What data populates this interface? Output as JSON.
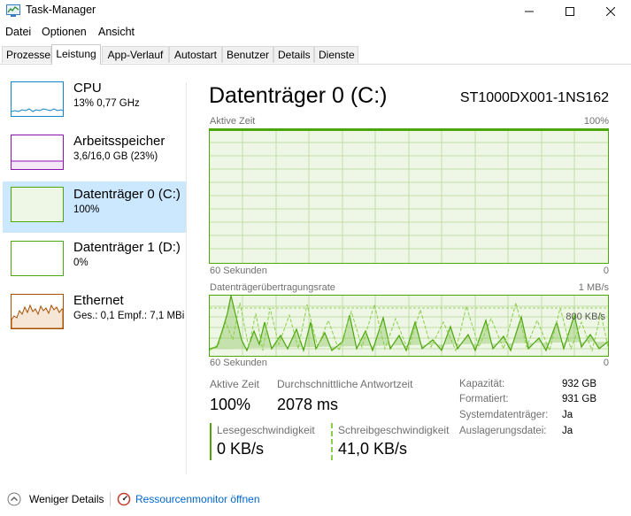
{
  "window": {
    "title": "Task-Manager"
  },
  "menu": [
    "Datei",
    "Optionen",
    "Ansicht"
  ],
  "tabs": [
    "Prozesse",
    "Leistung",
    "App-Verlauf",
    "Autostart",
    "Benutzer",
    "Details",
    "Dienste"
  ],
  "active_tab": "Leistung",
  "sidebar": [
    {
      "title": "CPU",
      "subtitle": "13% 0,77 GHz",
      "color": "#1185c7"
    },
    {
      "title": "Arbeitsspeicher",
      "subtitle": "3,6/16,0 GB (23%)",
      "color": "#8b12ae"
    },
    {
      "title": "Datenträger 0 (C:)",
      "subtitle": "100%",
      "color": "#4da60c"
    },
    {
      "title": "Datenträger 1 (D:)",
      "subtitle": "0%",
      "color": "#4da60c"
    },
    {
      "title": "Ethernet",
      "subtitle": "Ges.: 0,1  Empf.: 7,1 MBi",
      "color": "#a74f01"
    }
  ],
  "selected_sidebar_index": 2,
  "main": {
    "title": "Datenträger 0 (C:)",
    "model": "ST1000DX001-1NS162",
    "graph1": {
      "label": "Aktive Zeit",
      "max": "100%",
      "time": "60 Sekunden",
      "min": "0",
      "level_fraction": 1.0
    },
    "graph2": {
      "label": "Datenträgerübertragungsrate",
      "max": "1 MB/s",
      "mid": "800 KB/s",
      "time": "60 Sekunden",
      "min": "0"
    },
    "stats": {
      "active_time_label": "Aktive Zeit",
      "active_time_value": "100%",
      "avg_response_label": "Durchschnittliche Antwortzeit",
      "avg_response_value": "2078 ms",
      "read_label": "Lesegeschwindigkeit",
      "read_value": "0 KB/s",
      "write_label": "Schreibgeschwindigkeit",
      "write_value": "41,0 KB/s"
    },
    "props": [
      {
        "label": "Kapazität:",
        "value": "932 GB"
      },
      {
        "label": "Formatiert:",
        "value": "931 GB"
      },
      {
        "label": "Systemdatenträger:",
        "value": "Ja"
      },
      {
        "label": "Auslagerungsdatei:",
        "value": "Ja"
      }
    ]
  },
  "footer": {
    "fewer_details": "Weniger Details",
    "resource_monitor": "Ressourcenmonitor öffnen"
  },
  "colors": {
    "disk_green": "#4da60c",
    "disk_bg": "#eef6e5",
    "selection": "#cce8ff",
    "link": "#0066cc"
  }
}
